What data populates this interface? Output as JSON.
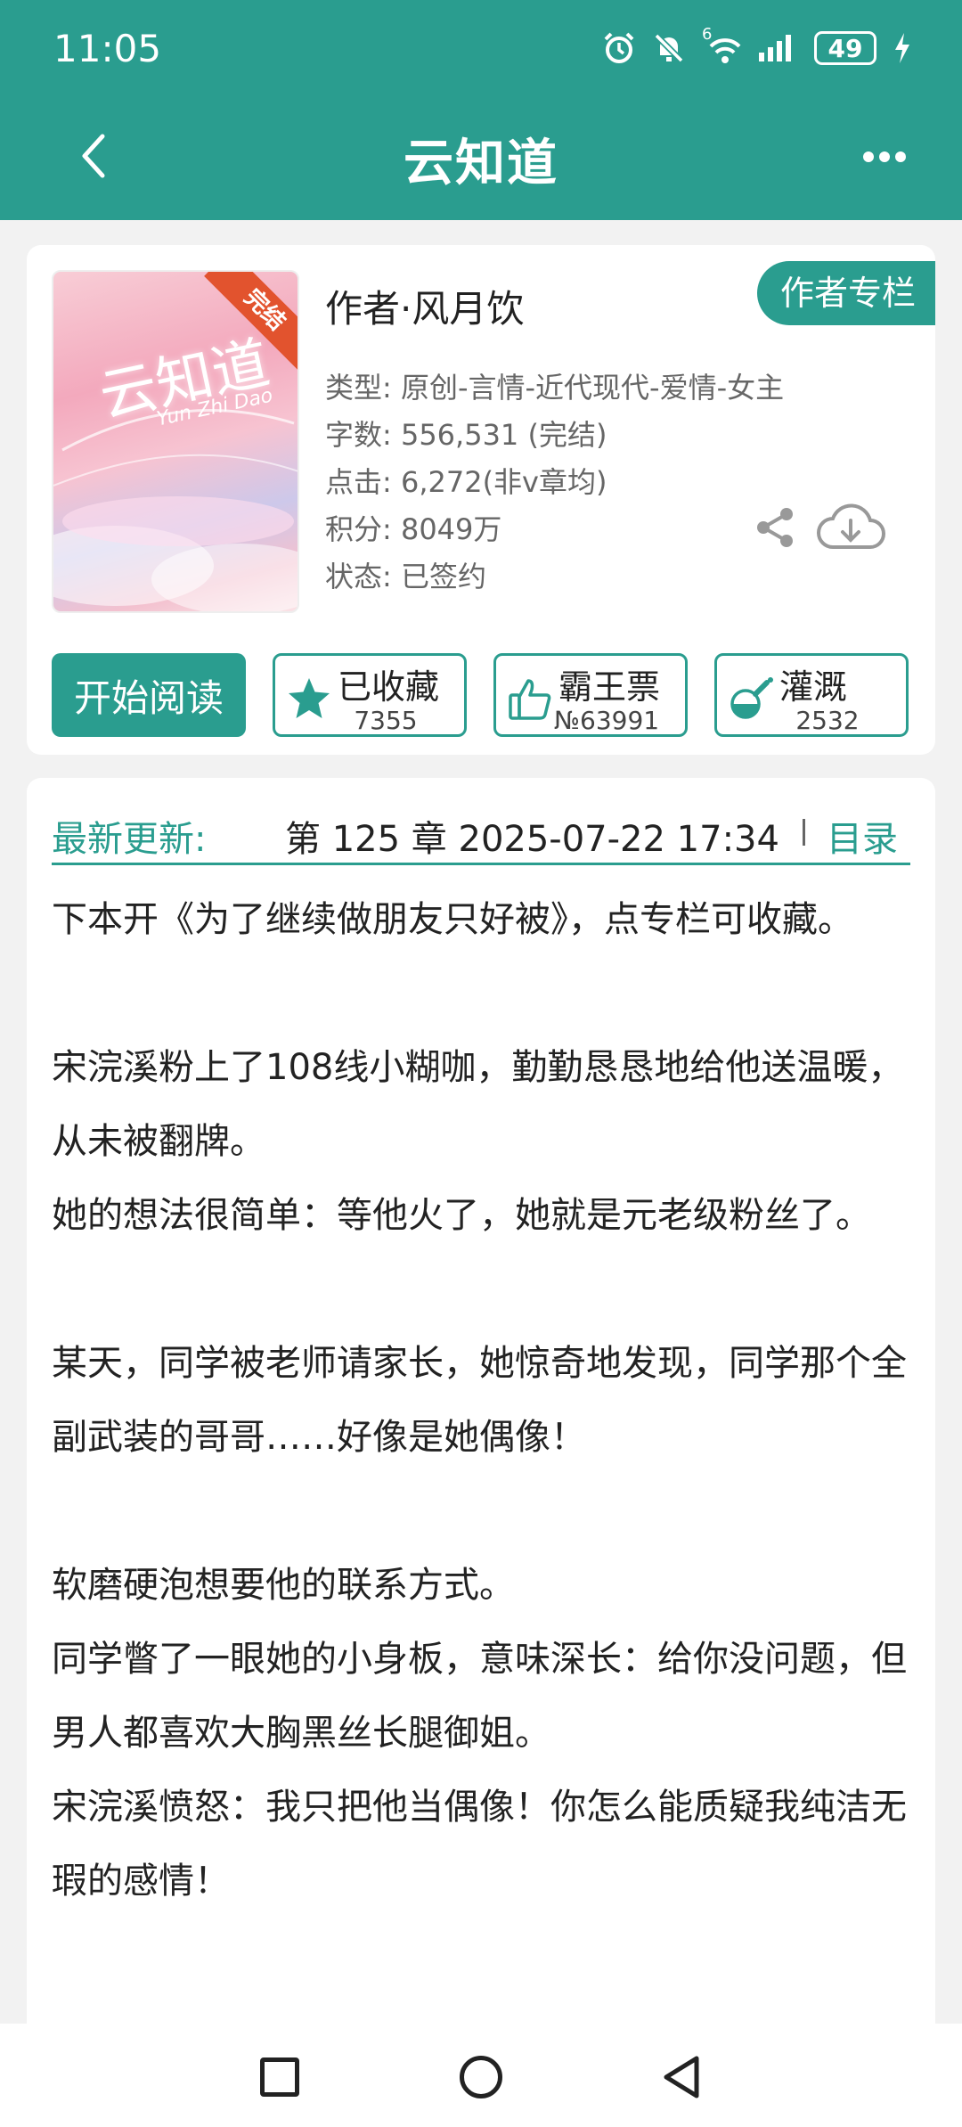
{
  "status_bar": {
    "time": "11:05",
    "signal_label": "6",
    "battery": "49"
  },
  "header": {
    "title": "云知道"
  },
  "book": {
    "cover_title": "云知道",
    "cover_subtitle": "Yun Zhi Dao",
    "badge": "完结",
    "author": "作者·风月饮",
    "author_column_button": "作者专栏",
    "type": "类型: 原创-言情-近代现代-爱情-女主",
    "word_count": "字数: 556,531 (完结)",
    "clicks": "点击: 6,272(非v章均)",
    "score": "积分: 8049万",
    "status": "状态: 已签约"
  },
  "actions": {
    "start_reading": "开始阅读",
    "collect": {
      "label": "已收藏",
      "count": "7355"
    },
    "overlord": {
      "label": "霸王票",
      "count": "№63991"
    },
    "nutrient": {
      "label": "灌溉",
      "count": "2532"
    }
  },
  "update": {
    "label": "最新更新:",
    "text": "第 125 章  2025-07-22 17:34",
    "toc": "目录"
  },
  "synopsis": "下本开《为了继续做朋友只好被》，点专栏可收藏。\n\n宋浣溪粉上了108线小糊咖，勤勤恳恳地给他送温暖，从未被翻牌。\n她的想法很简单：等他火了，她就是元老级粉丝了。\n\n某天，同学被老师请家长，她惊奇地发现，同学那个全副武装的哥哥……好像是她偶像！\n\n软磨硬泡想要他的联系方式。\n同学瞥了一眼她的小身板，意味深长：给你没问题，但男人都喜欢大胸黑丝长腿御姐。\n宋浣溪愤怒：我只把他当偶像！你怎么能质疑我纯洁无瑕的感情！",
  "colors": {
    "accent": "#2a9d8f",
    "ribbon": "#e2532e"
  }
}
